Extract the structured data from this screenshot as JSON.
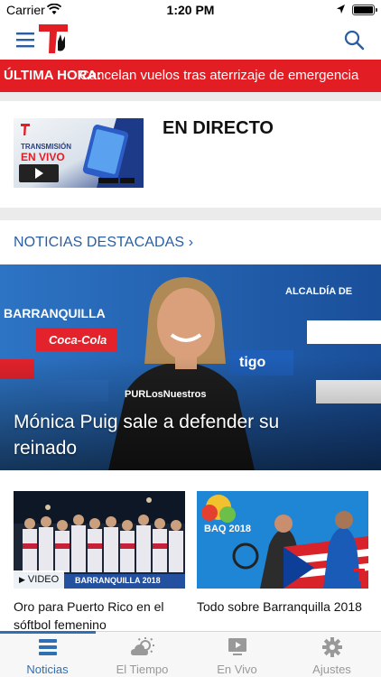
{
  "status_bar": {
    "carrier": "Carrier",
    "time": "1:20 PM"
  },
  "header": {
    "brand": "Telemundo"
  },
  "breaking": {
    "tag": "ÚLTIMA HORA:",
    "text": "Cancelan vuelos tras aterrizaje de emergencia"
  },
  "live": {
    "title": "EN DIRECTO",
    "thumb_line1": "TRANSMISIÓN",
    "thumb_line2": "EN VIVO"
  },
  "featured": {
    "label": "NOTICIAS DESTACADAS",
    "chevron": "›"
  },
  "hero": {
    "headline": "Mónica Puig sale a defender su reinado",
    "banner_words": [
      "BARRANQUILLA",
      "ALCALDÍA DE",
      "Coca-Cola",
      "tigo",
      "PURLosNuestros"
    ]
  },
  "articles": [
    {
      "caption": "Oro para Puerto Rico en el sóftbol femenino",
      "badge": "VIDEO",
      "image_text": "BARRANQUILLA 2018"
    },
    {
      "caption": "Todo sobre Barranquilla 2018",
      "image_text": "BAQ 2018"
    }
  ],
  "tabs": [
    {
      "label": "Noticias",
      "icon": "news-icon",
      "active": true
    },
    {
      "label": "El Tiempo",
      "icon": "weather-icon",
      "active": false
    },
    {
      "label": "En Vivo",
      "icon": "tv-play-icon",
      "active": false
    },
    {
      "label": "Ajustes",
      "icon": "gear-icon",
      "active": false
    }
  ],
  "colors": {
    "brand_red": "#e31d24",
    "link_blue": "#2a5ea0",
    "tab_active": "#2f6fb3"
  }
}
